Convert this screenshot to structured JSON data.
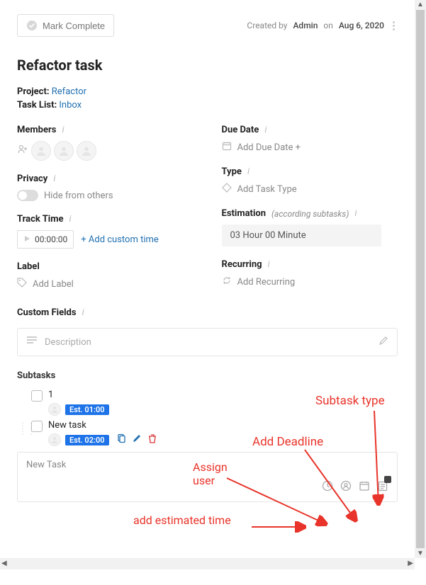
{
  "topbar": {
    "mark_complete": "Mark Complete",
    "created_prefix": "Created by",
    "created_user": "Admin",
    "created_mid": "on",
    "created_date": "Aug 6, 2020"
  },
  "title": "Refactor task",
  "meta": {
    "project_label": "Project:",
    "project_value": "Refactor",
    "tasklist_label": "Task List:",
    "tasklist_value": "Inbox"
  },
  "members": {
    "heading": "Members"
  },
  "privacy": {
    "heading": "Privacy",
    "toggle_label": "Hide from others"
  },
  "track_time": {
    "heading": "Track Time",
    "value": "00:00:00",
    "add_custom": "+ Add custom time"
  },
  "label": {
    "heading": "Label",
    "placeholder": "Add Label"
  },
  "due_date": {
    "heading": "Due Date",
    "placeholder": "Add Due Date +"
  },
  "type": {
    "heading": "Type",
    "placeholder": "Add Task Type"
  },
  "estimation": {
    "heading": "Estimation",
    "note": "(according subtasks)",
    "value": "03 Hour   00 Minute"
  },
  "recurring": {
    "heading": "Recurring",
    "placeholder": "Add Recurring"
  },
  "custom_fields": {
    "heading": "Custom Fields"
  },
  "description": {
    "placeholder": "Description"
  },
  "subtasks": {
    "heading": "Subtasks",
    "items": [
      {
        "title": "1",
        "est": "Est. 01:00"
      },
      {
        "title": "New task",
        "est": "Est. 02:00"
      }
    ],
    "new_placeholder": "New Task"
  },
  "annotations": {
    "subtask_type": "Subtask type",
    "add_deadline": "Add Deadline",
    "assign_user": "Assign user",
    "add_estimated": "add estimated time"
  }
}
